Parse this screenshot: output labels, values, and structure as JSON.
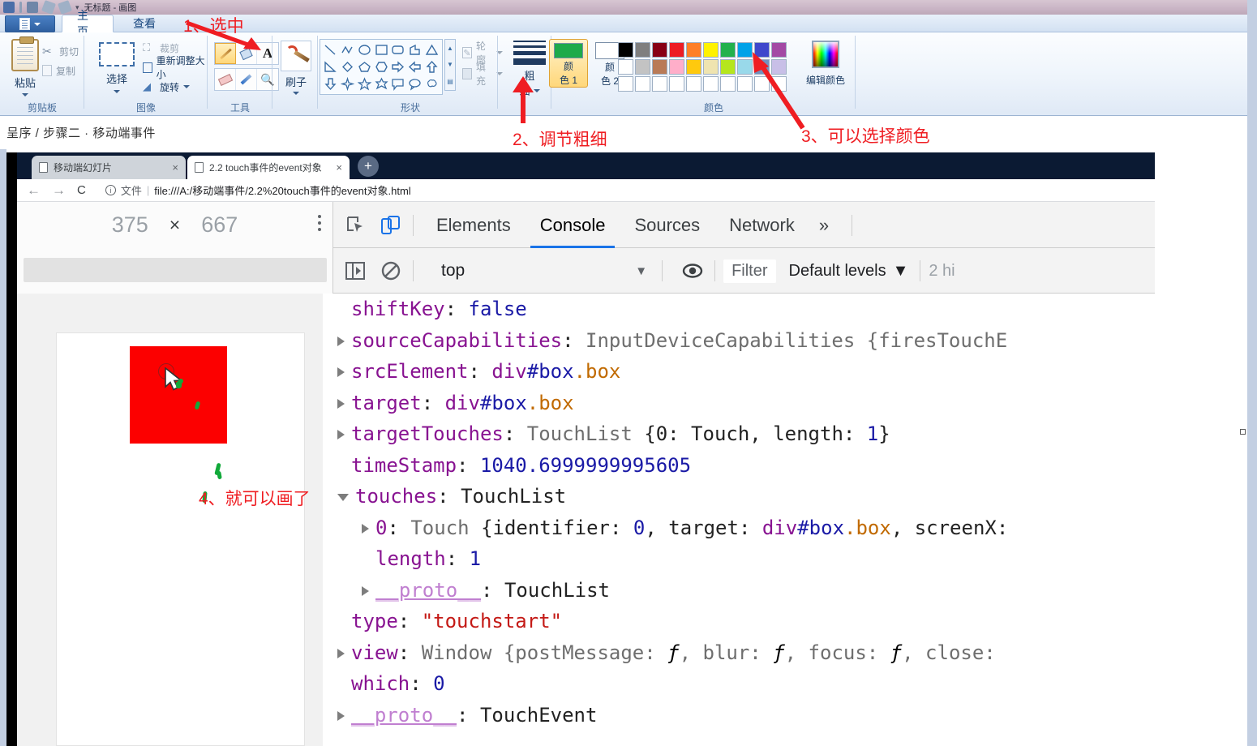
{
  "paint": {
    "titlebar_text": "无标题 - 画图",
    "quick_access_name": "paint-menu-button",
    "tabs": [
      {
        "label": "主页",
        "active": true
      },
      {
        "label": "查看",
        "active": false
      }
    ],
    "groups": {
      "clipboard": {
        "label": "剪贴板",
        "paste": "粘贴",
        "cut": "剪切",
        "copy": "复制"
      },
      "image": {
        "label": "图像",
        "select": "选择",
        "crop": "裁剪",
        "resize": "重新调整大小",
        "rotate": "旋转"
      },
      "tools": {
        "label": "工具",
        "items": [
          "pencil-icon",
          "fill-icon",
          "text-icon",
          "eraser-icon",
          "color-picker-icon",
          "magnifier-icon"
        ],
        "selected": "pencil-icon"
      },
      "brushes": {
        "label": "刷子"
      },
      "shapes": {
        "label": "形状",
        "outline": "轮廓",
        "fill": "填充",
        "size_label_1": "粗",
        "size_label_2": "细"
      },
      "colors": {
        "label": "颜色",
        "color1_label_1": "颜",
        "color1_label_2": "色 1",
        "color2_label_1": "颜",
        "color2_label_2": "色 2",
        "color1_value": "#1faa4a",
        "color2_value": "#ffffff",
        "edit_colors": "编辑颜色",
        "row1": [
          "#000000",
          "#7f7f7f",
          "#880015",
          "#ed1c24",
          "#ff7f27",
          "#fff200",
          "#22b14c",
          "#00a2e8",
          "#3f48cc",
          "#a349a4"
        ],
        "row2": [
          "#ffffff",
          "#c3c3c3",
          "#b97a57",
          "#ffaec9",
          "#ffc90e",
          "#efe4b0",
          "#b5e61d",
          "#99d9ea",
          "#7092be",
          "#c8bfe7"
        ],
        "row3": [
          "#ffffff",
          "#ffffff",
          "#ffffff",
          "#ffffff",
          "#ffffff",
          "#ffffff",
          "#ffffff",
          "#ffffff",
          "#ffffff",
          "#ffffff"
        ]
      }
    }
  },
  "breadcrumb": {
    "text": "呈序 / 步骤二 · 移动端事件"
  },
  "annotations": [
    {
      "id": 1,
      "text": "1、选中"
    },
    {
      "id": 2,
      "text": "2、调节粗细"
    },
    {
      "id": 3,
      "text": "3、可以选择颜色"
    },
    {
      "id": 4,
      "text": "4、就可以画了"
    }
  ],
  "browser": {
    "tabs": [
      {
        "label": "移动端幻灯片",
        "active": false
      },
      {
        "label": "2.2 touch事件的event对象",
        "active": true
      }
    ],
    "new_tab_label": "+",
    "close_label": "×",
    "nav": {
      "back": "←",
      "forward": "→",
      "reload": "C"
    },
    "url_prefix": "文件",
    "url": "file:///A:/移动端事件/2.2%20touch事件的event对象.html"
  },
  "devtools": {
    "device": {
      "width": "375",
      "x": "×",
      "height": "667"
    },
    "tabs": [
      {
        "label": "Elements",
        "active": false
      },
      {
        "label": "Console",
        "active": true
      },
      {
        "label": "Sources",
        "active": false
      },
      {
        "label": "Network",
        "active": false
      }
    ],
    "more_tabs": "»",
    "console_bar": {
      "context": "top",
      "context_caret": "▼",
      "filter_placeholder": "Filter",
      "levels": "Default levels",
      "levels_caret": "▼",
      "hidden_messages": "2 hi"
    },
    "console_lines": [
      {
        "indent": 0,
        "arrow": "none",
        "tokens": [
          {
            "t": "shiftKey",
            "c": "k"
          },
          {
            "t": ": ",
            "c": "plain"
          },
          {
            "t": "false",
            "c": "num"
          }
        ]
      },
      {
        "indent": 0,
        "arrow": "closed",
        "tokens": [
          {
            "t": "sourceCapabilities",
            "c": "k"
          },
          {
            "t": ": ",
            "c": "plain"
          },
          {
            "t": "InputDeviceCapabilities {firesTouchE",
            "c": "obj"
          }
        ]
      },
      {
        "indent": 0,
        "arrow": "closed",
        "tokens": [
          {
            "t": "srcElement",
            "c": "k"
          },
          {
            "t": ": ",
            "c": "plain"
          },
          {
            "t": "div",
            "c": "dom-t"
          },
          {
            "t": "#box",
            "c": "dom-h"
          },
          {
            "t": ".box",
            "c": "dom-c"
          }
        ]
      },
      {
        "indent": 0,
        "arrow": "closed",
        "tokens": [
          {
            "t": "target",
            "c": "k"
          },
          {
            "t": ": ",
            "c": "plain"
          },
          {
            "t": "div",
            "c": "dom-t"
          },
          {
            "t": "#box",
            "c": "dom-h"
          },
          {
            "t": ".box",
            "c": "dom-c"
          }
        ]
      },
      {
        "indent": 0,
        "arrow": "closed",
        "tokens": [
          {
            "t": "targetTouches",
            "c": "k"
          },
          {
            "t": ": ",
            "c": "plain"
          },
          {
            "t": "TouchList ",
            "c": "obj"
          },
          {
            "t": "{0: ",
            "c": "plain"
          },
          {
            "t": "Touch",
            "c": "plain"
          },
          {
            "t": ", length: ",
            "c": "plain"
          },
          {
            "t": "1",
            "c": "num"
          },
          {
            "t": "}",
            "c": "plain"
          }
        ]
      },
      {
        "indent": 0,
        "arrow": "none",
        "tokens": [
          {
            "t": "timeStamp",
            "c": "k"
          },
          {
            "t": ": ",
            "c": "plain"
          },
          {
            "t": "1040.6999999995605",
            "c": "num"
          }
        ]
      },
      {
        "indent": 0,
        "arrow": "open",
        "tokens": [
          {
            "t": "touches",
            "c": "k"
          },
          {
            "t": ": ",
            "c": "plain"
          },
          {
            "t": "TouchList",
            "c": "plain"
          }
        ]
      },
      {
        "indent": 1,
        "arrow": "closed",
        "tokens": [
          {
            "t": "0",
            "c": "k"
          },
          {
            "t": ": ",
            "c": "plain"
          },
          {
            "t": "Touch ",
            "c": "obj"
          },
          {
            "t": "{identifier: ",
            "c": "plain"
          },
          {
            "t": "0",
            "c": "num"
          },
          {
            "t": ", target: ",
            "c": "plain"
          },
          {
            "t": "div",
            "c": "dom-t"
          },
          {
            "t": "#box",
            "c": "dom-h"
          },
          {
            "t": ".box",
            "c": "dom-c"
          },
          {
            "t": ", screenX:",
            "c": "plain"
          }
        ]
      },
      {
        "indent": 1,
        "arrow": "none",
        "tokens": [
          {
            "t": "length",
            "c": "k"
          },
          {
            "t": ": ",
            "c": "plain"
          },
          {
            "t": "1",
            "c": "num"
          }
        ]
      },
      {
        "indent": 1,
        "arrow": "closed",
        "tokens": [
          {
            "t": "__proto__",
            "c": "kp"
          },
          {
            "t": ": ",
            "c": "plain"
          },
          {
            "t": "TouchList",
            "c": "plain"
          }
        ]
      },
      {
        "indent": 0,
        "arrow": "none",
        "tokens": [
          {
            "t": "type",
            "c": "k"
          },
          {
            "t": ": ",
            "c": "plain"
          },
          {
            "t": "\"touchstart\"",
            "c": "str"
          }
        ]
      },
      {
        "indent": 0,
        "arrow": "closed",
        "tokens": [
          {
            "t": "view",
            "c": "k"
          },
          {
            "t": ": ",
            "c": "plain"
          },
          {
            "t": "Window ",
            "c": "obj"
          },
          {
            "t": "{postMessage: ",
            "c": "obj"
          },
          {
            "t": "ƒ",
            "c": "ital"
          },
          {
            "t": ", blur: ",
            "c": "obj"
          },
          {
            "t": "ƒ",
            "c": "ital"
          },
          {
            "t": ", focus: ",
            "c": "obj"
          },
          {
            "t": "ƒ",
            "c": "ital"
          },
          {
            "t": ", close:",
            "c": "obj"
          }
        ]
      },
      {
        "indent": 0,
        "arrow": "none",
        "tokens": [
          {
            "t": "which",
            "c": "k"
          },
          {
            "t": ": ",
            "c": "plain"
          },
          {
            "t": "0",
            "c": "num"
          }
        ]
      },
      {
        "indent": 0,
        "arrow": "closed",
        "tokens": [
          {
            "t": "__proto__",
            "c": "kp"
          },
          {
            "t": ": ",
            "c": "plain"
          },
          {
            "t": "TouchEvent",
            "c": "plain"
          }
        ]
      }
    ]
  },
  "viewport": {
    "box_color": "#fc0000",
    "ink_color": "#12a93a"
  }
}
